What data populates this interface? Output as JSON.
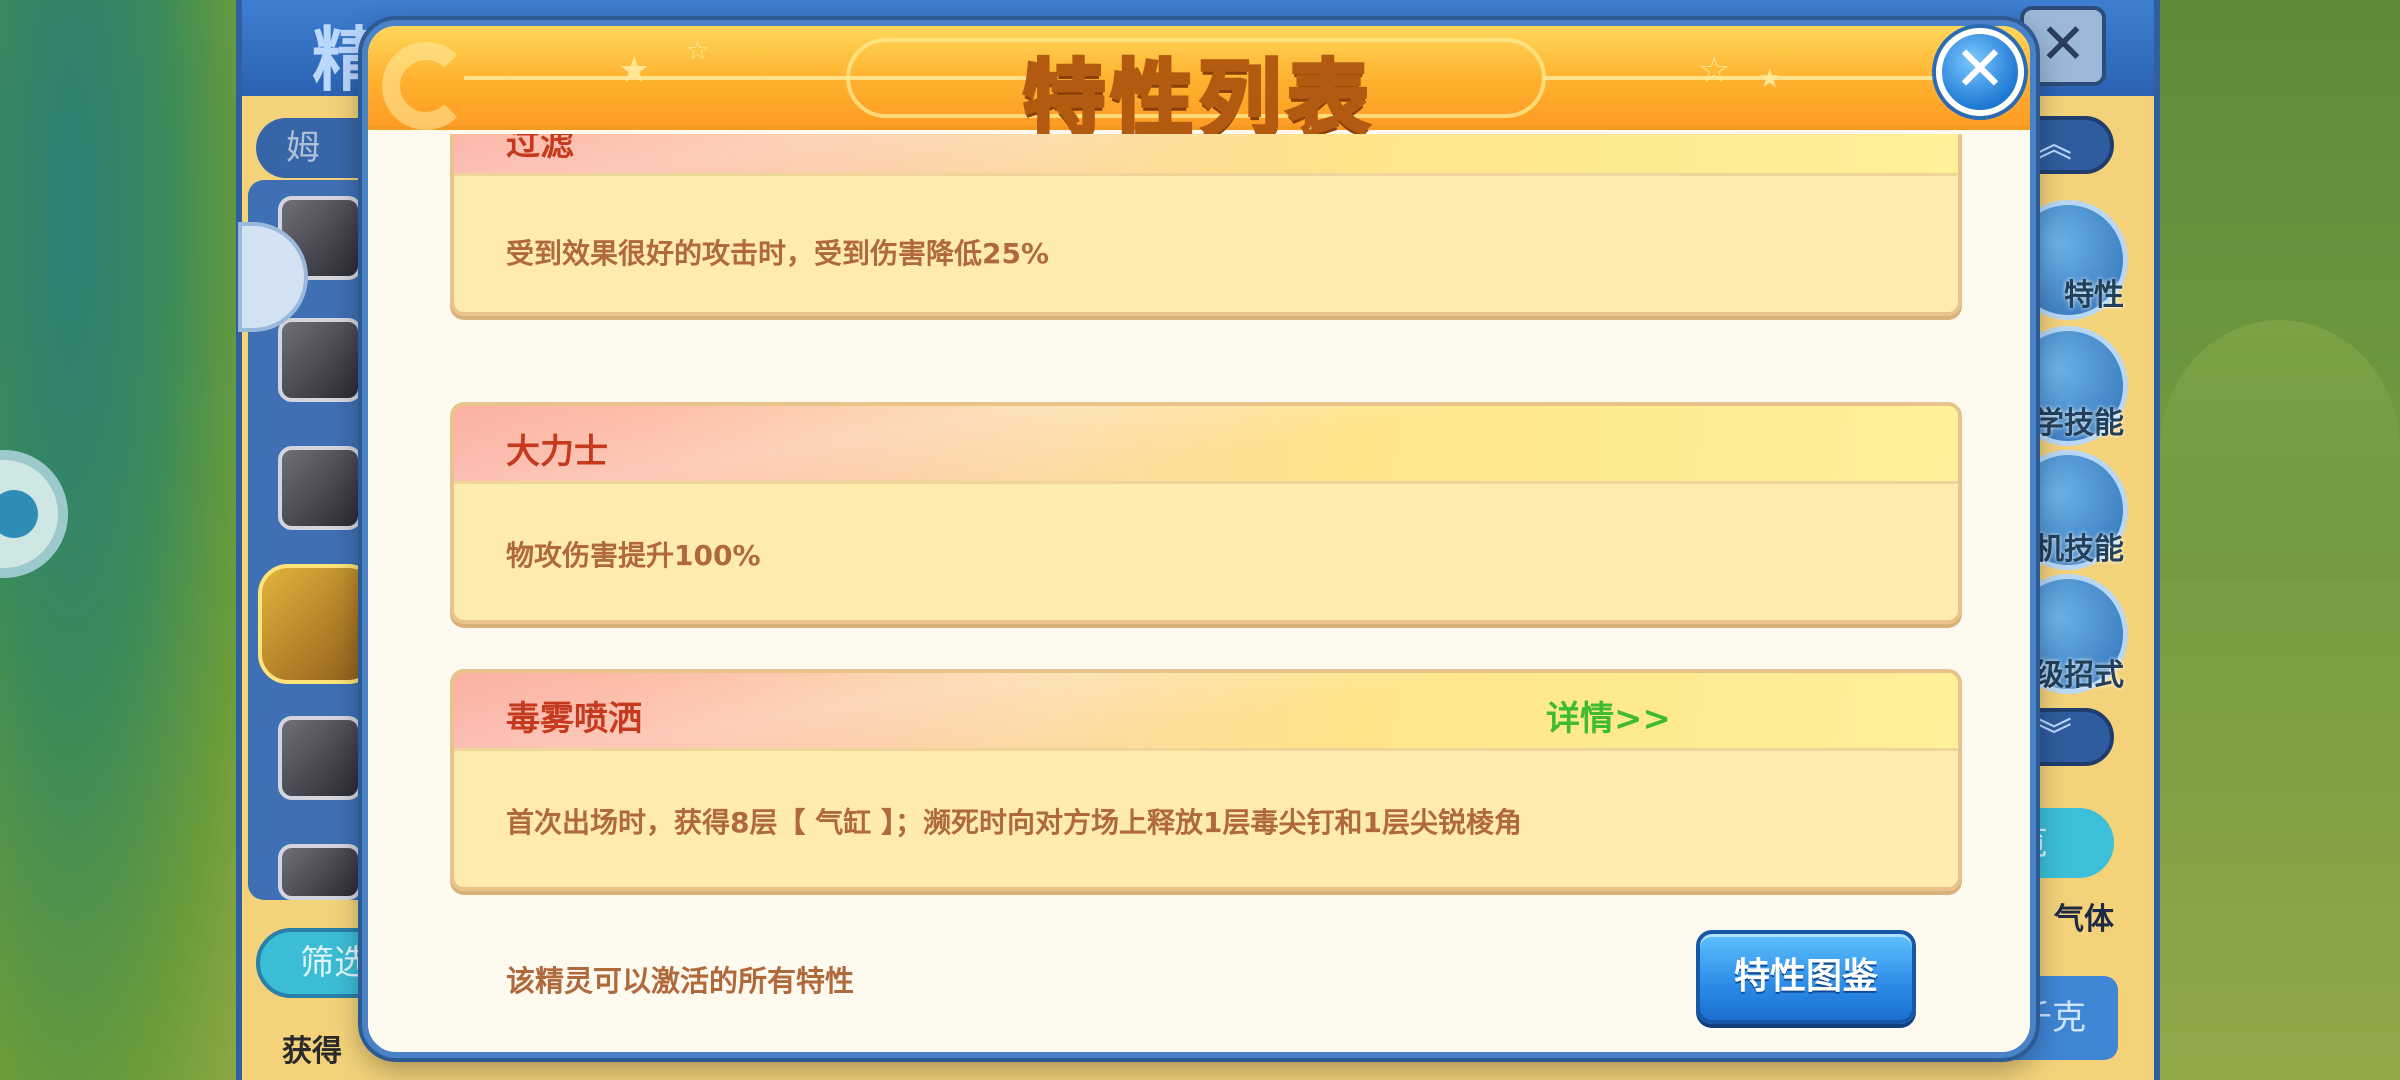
{
  "background": {
    "title": "精灵图鉴",
    "search_text": "姆",
    "filter_label": "筛选",
    "bottom_text": "获得",
    "right_menu": [
      "特性",
      "学技能",
      "机技能",
      "级招式"
    ],
    "preview_label": "览",
    "gas_label": "气体",
    "blue_button_label": "千克"
  },
  "modal": {
    "title": "特性列表",
    "close_glyph": "✕",
    "traits": [
      {
        "name": "过滤",
        "description": "受到效果很好的攻击时，受到伤害降低25%",
        "detail_link": ""
      },
      {
        "name": "大力士",
        "description": "物攻伤害提升100%",
        "detail_link": ""
      },
      {
        "name": "毒雾喷洒",
        "description": "首次出场时，获得8层【 气缸 】；濒死时向对方场上释放1层毒尖钉和1层尖锐棱角",
        "detail_link": "详情>>"
      }
    ],
    "footer_note": "该精灵可以激活的所有特性",
    "guide_button": "特性图鉴"
  },
  "colors": {
    "header_orange": "#ffb12e",
    "trait_name": "#c53a1f",
    "trait_desc": "#b0693a",
    "detail_green": "#3fbb2e",
    "button_blue": "#2b8be6"
  }
}
